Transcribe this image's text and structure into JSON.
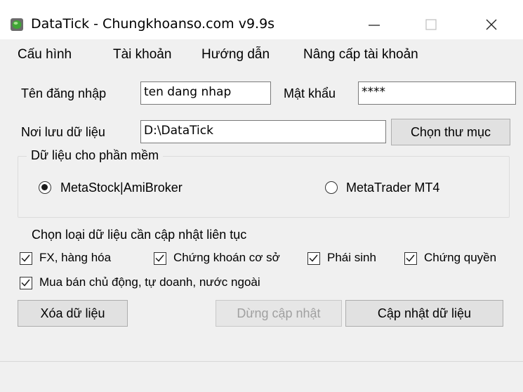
{
  "window": {
    "title": "DataTick - Chungkhoanso.com v9.9s"
  },
  "menu": {
    "items": [
      "Cấu hình",
      "Tài khoản",
      "Hướng dẫn",
      "Nâng cấp tài khoản"
    ]
  },
  "login": {
    "username_label": "Tên đăng nhập",
    "username_value": "ten dang nhap",
    "password_label": "Mật khẩu",
    "password_value": "****"
  },
  "storage": {
    "label": "Nơi lưu dữ liệu",
    "path_value": "D:\\DataTick",
    "choose_button": "Chọn thư mục"
  },
  "software": {
    "group_title": "Dữ liệu cho phần mềm",
    "options": [
      {
        "label": "MetaStock|AmiBroker",
        "selected": true
      },
      {
        "label": "MetaTrader MT4",
        "selected": false
      }
    ]
  },
  "data_types": {
    "heading": "Chọn loại dữ liệu cần cập nhật liên tục",
    "options": [
      {
        "label": "FX, hàng hóa",
        "checked": true
      },
      {
        "label": "Chứng khoán cơ sở",
        "checked": true
      },
      {
        "label": "Phái sinh",
        "checked": true
      },
      {
        "label": "Chứng quyền",
        "checked": true
      },
      {
        "label": "Mua bán chủ động, tự doanh, nước ngoài",
        "checked": true
      }
    ]
  },
  "actions": {
    "delete_label": "Xóa dữ liệu",
    "stop_label": "Dừng cập nhật",
    "update_label": "Cập nhật dữ liệu"
  },
  "icons": {
    "app": "datatick-leaf-icon",
    "minimize": "minimize-icon",
    "maximize": "maximize-icon",
    "close": "close-icon",
    "check": "checkmark-icon"
  },
  "colors": {
    "disabled_text": "#a0a0a0",
    "face": "#f0f0f0",
    "button": "#e1e1e1"
  }
}
